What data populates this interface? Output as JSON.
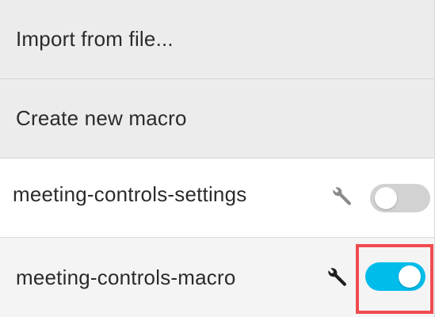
{
  "actions": {
    "import_label": "Import from file...",
    "create_label": "Create new macro"
  },
  "macros": [
    {
      "name": "meeting-controls-settings",
      "enabled": false,
      "edit_icon": "wrench-icon"
    },
    {
      "name": "meeting-controls-macro",
      "enabled": true,
      "edit_icon": "wrench-icon"
    }
  ],
  "colors": {
    "toggle_on": "#00bceb",
    "toggle_off": "#d2d2d2",
    "highlight": "#f04a4f"
  }
}
